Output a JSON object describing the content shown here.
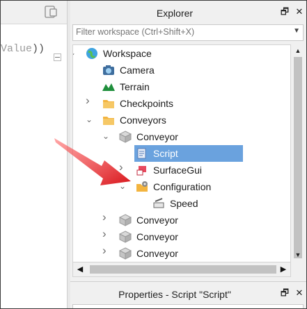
{
  "editor": {
    "code_fragment": "Value",
    "code_suffix": "))"
  },
  "explorer": {
    "title": "Explorer",
    "float_label": "🗗",
    "close_label": "✕",
    "filter_placeholder": "Filter workspace (Ctrl+Shift+X)",
    "tree": [
      {
        "label": "Workspace",
        "icon": "workspace-globe-icon",
        "depth": 0,
        "state": "expanded"
      },
      {
        "label": "Camera",
        "icon": "camera-icon",
        "depth": 1,
        "state": "none"
      },
      {
        "label": "Terrain",
        "icon": "terrain-icon",
        "depth": 1,
        "state": "none"
      },
      {
        "label": "Checkpoints",
        "icon": "folder-icon",
        "depth": 1,
        "state": "collapsed"
      },
      {
        "label": "Conveyors",
        "icon": "folder-icon",
        "depth": 1,
        "state": "expanded"
      },
      {
        "label": "Conveyor",
        "icon": "model-icon",
        "depth": 2,
        "state": "expanded"
      },
      {
        "label": "Script",
        "icon": "script-icon",
        "depth": 3,
        "state": "none",
        "selected": true
      },
      {
        "label": "SurfaceGui",
        "icon": "surfacegui-icon",
        "depth": 3,
        "state": "collapsed"
      },
      {
        "label": "Configuration",
        "icon": "configuration-icon",
        "depth": 3,
        "state": "expanded"
      },
      {
        "label": "Speed",
        "icon": "number-value-icon",
        "depth": 4,
        "state": "none"
      },
      {
        "label": "Conveyor",
        "icon": "model-icon",
        "depth": 2,
        "state": "collapsed"
      },
      {
        "label": "Conveyor",
        "icon": "model-icon",
        "depth": 2,
        "state": "collapsed"
      },
      {
        "label": "Conveyor",
        "icon": "model-icon",
        "depth": 2,
        "state": "collapsed"
      }
    ]
  },
  "properties": {
    "title": "Properties - Script \"Script\""
  },
  "colors": {
    "selection": "#6aa2de",
    "arrow": "#e0242a",
    "folder": "#f3b43f"
  }
}
